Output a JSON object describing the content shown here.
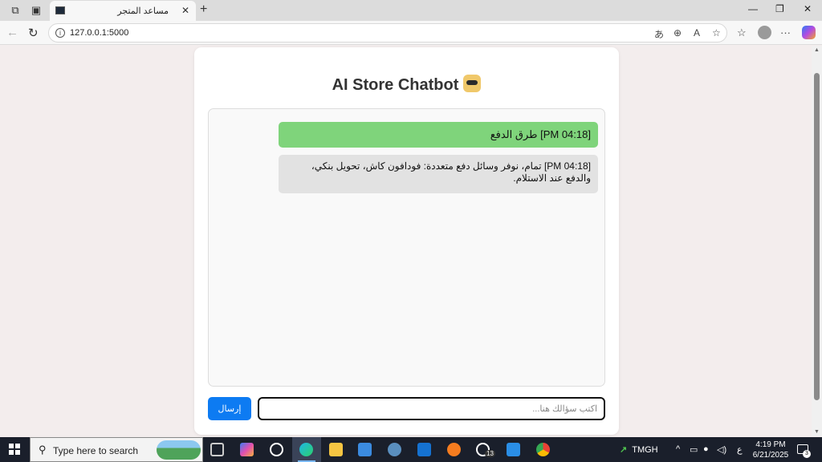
{
  "browser": {
    "tab_title": "مساعد المتجر",
    "tab_close": "✕",
    "new_tab": "+",
    "url": "127.0.0.1:5000",
    "window_controls": {
      "minimize": "—",
      "restore": "❐",
      "close": "✕"
    },
    "nav": {
      "back": "←",
      "reload": "↻"
    },
    "omnibox_icons": {
      "translate": "あ",
      "zoom": "⊕",
      "read_aloud": "A",
      "favorite": "☆"
    },
    "toolbar": {
      "favorites": "☆",
      "menu": "···"
    }
  },
  "page": {
    "title": "AI Store Chatbot",
    "messages": [
      {
        "role": "user",
        "text": "[04:18 PM] طرق الدفع"
      },
      {
        "role": "bot",
        "text": "[04:18 PM] تمام، نوفر وسائل دفع متعددة: فودافون كاش، تحويل بنكي، والدفع عند الاستلام."
      }
    ],
    "input": {
      "placeholder": "اكتب سؤالك هنا...",
      "value": ""
    },
    "send_label": "إرسال",
    "colors": {
      "user_bubble": "#7fd47b",
      "bot_bubble": "#e2e2e2",
      "send_button": "#0d7bf2"
    }
  },
  "taskbar": {
    "search_placeholder": "Type here to search",
    "whatsapp_badge": "13",
    "stock": {
      "symbol": "TMGH"
    },
    "tray": {
      "language": "ع"
    },
    "clock": {
      "time": "4:19 PM",
      "date": "6/21/2025"
    },
    "notification_count": "3"
  }
}
